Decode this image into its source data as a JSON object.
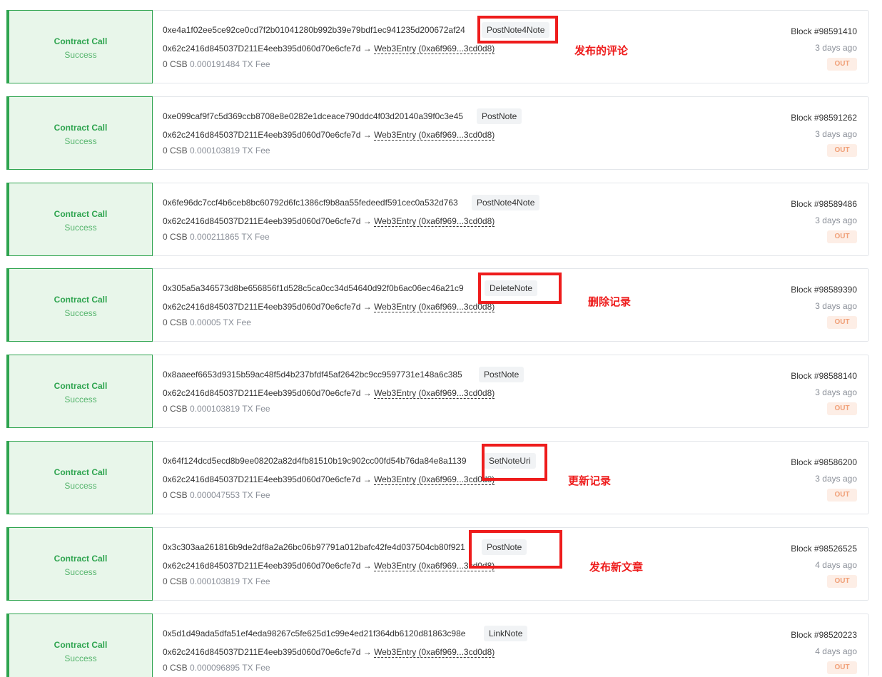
{
  "transactions": [
    {
      "status_type": "Contract Call",
      "status_result": "Success",
      "hash": "0xe4a1f02ee5ce92ce0cd7f2b01041280b992b39e79bdf1ec941235d200672af24",
      "method": "PostNote4Note",
      "from": "0x62c2416d845037D211E4eeb395d060d70e6cfe7d",
      "arrow": "→",
      "to": "Web3Entry (0xa6f969...3cd0d8)",
      "value": "0 CSB",
      "fee": "0.000191484 TX Fee",
      "block": "Block #98591410",
      "time": "3 days ago",
      "direction": "OUT"
    },
    {
      "status_type": "Contract Call",
      "status_result": "Success",
      "hash": "0xe099caf9f7c5d369ccb8708e8e0282e1dceace790ddc4f03d20140a39f0c3e45",
      "method": "PostNote",
      "from": "0x62c2416d845037D211E4eeb395d060d70e6cfe7d",
      "arrow": "→",
      "to": "Web3Entry (0xa6f969...3cd0d8)",
      "value": "0 CSB",
      "fee": "0.000103819 TX Fee",
      "block": "Block #98591262",
      "time": "3 days ago",
      "direction": "OUT"
    },
    {
      "status_type": "Contract Call",
      "status_result": "Success",
      "hash": "0x6fe96dc7ccf4b6ceb8bc60792d6fc1386cf9b8aa55fedeedf591cec0a532d763",
      "method": "PostNote4Note",
      "from": "0x62c2416d845037D211E4eeb395d060d70e6cfe7d",
      "arrow": "→",
      "to": "Web3Entry (0xa6f969...3cd0d8)",
      "value": "0 CSB",
      "fee": "0.000211865 TX Fee",
      "block": "Block #98589486",
      "time": "3 days ago",
      "direction": "OUT"
    },
    {
      "status_type": "Contract Call",
      "status_result": "Success",
      "hash": "0x305a5a346573d8be656856f1d528c5ca0cc34d54640d92f0b6ac06ec46a21c9",
      "method": "DeleteNote",
      "from": "0x62c2416d845037D211E4eeb395d060d70e6cfe7d",
      "arrow": "→",
      "to": "Web3Entry (0xa6f969...3cd0d8)",
      "value": "0 CSB",
      "fee": "0.00005 TX Fee",
      "block": "Block #98589390",
      "time": "3 days ago",
      "direction": "OUT"
    },
    {
      "status_type": "Contract Call",
      "status_result": "Success",
      "hash": "0x8aaeef6653d9315b59ac48f5d4b237bfdf45af2642bc9cc9597731e148a6c385",
      "method": "PostNote",
      "from": "0x62c2416d845037D211E4eeb395d060d70e6cfe7d",
      "arrow": "→",
      "to": "Web3Entry (0xa6f969...3cd0d8)",
      "value": "0 CSB",
      "fee": "0.000103819 TX Fee",
      "block": "Block #98588140",
      "time": "3 days ago",
      "direction": "OUT"
    },
    {
      "status_type": "Contract Call",
      "status_result": "Success",
      "hash": "0x64f124dcd5ecd8b9ee08202a82d4fb81510b19c902cc00fd54b76da84e8a1139",
      "method": "SetNoteUri",
      "from": "0x62c2416d845037D211E4eeb395d060d70e6cfe7d",
      "arrow": "→",
      "to": "Web3Entry (0xa6f969...3cd0d8)",
      "value": "0 CSB",
      "fee": "0.000047553 TX Fee",
      "block": "Block #98586200",
      "time": "3 days ago",
      "direction": "OUT"
    },
    {
      "status_type": "Contract Call",
      "status_result": "Success",
      "hash": "0x3c303aa261816b9de2df8a2a26bc06b97791a012bafc42fe4d037504cb80f921",
      "method": "PostNote",
      "from": "0x62c2416d845037D211E4eeb395d060d70e6cfe7d",
      "arrow": "→",
      "to": "Web3Entry (0xa6f969...3cd0d8)",
      "value": "0 CSB",
      "fee": "0.000103819 TX Fee",
      "block": "Block #98526525",
      "time": "4 days ago",
      "direction": "OUT"
    },
    {
      "status_type": "Contract Call",
      "status_result": "Success",
      "hash": "0x5d1d49ada5dfa51ef4eda98267c5fe625d1c99e4ed21f364db6120d81863c98e",
      "method": "LinkNote",
      "from": "0x62c2416d845037D211E4eeb395d060d70e6cfe7d",
      "arrow": "→",
      "to": "Web3Entry (0xa6f969...3cd0d8)",
      "value": "0 CSB",
      "fee": "0.000096895 TX Fee",
      "block": "Block #98520223",
      "time": "4 days ago",
      "direction": "OUT"
    }
  ],
  "annotations": [
    {
      "text": "发布的评论"
    },
    {
      "text": "删除记录"
    },
    {
      "text": "更新记录"
    },
    {
      "text": "发布新文章"
    }
  ],
  "colors": {
    "success": "#2ea44f",
    "status_bg": "#e8f6ea",
    "out_badge_text": "#f0a078",
    "out_badge_bg": "#fdeee6",
    "annotation_red": "#ee1c1c"
  }
}
